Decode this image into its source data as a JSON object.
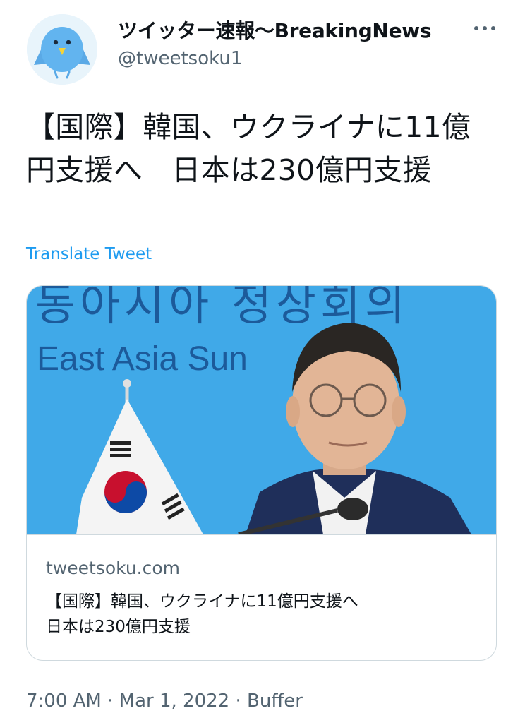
{
  "author": {
    "display_name": "ツイッター速報〜BreakingNews",
    "handle": "@tweetsoku1",
    "avatar_icon": "bird-avatar-icon"
  },
  "more_icon": "more-options-icon",
  "tweet": {
    "text": "【国際】韓国、ウクライナに11億円支援へ　日本は230億円支援",
    "translate_label": "Translate Tweet"
  },
  "card": {
    "image_text_en": "East Asia Sun",
    "image_text_ko": "동아시아 정상회의",
    "domain": "tweetsoku.com",
    "title": "【国際】韓国、ウクライナに11億円支援へ\n日本は230億円支援"
  },
  "meta": {
    "time": "7:00 AM",
    "separator": "·",
    "date": "Mar 1, 2022",
    "source": "Buffer",
    "full": "7:00 AM · Mar 1, 2022 · Buffer"
  },
  "colors": {
    "link": "#1d9bf0",
    "secondary_text": "#536471",
    "border": "#cfd9de",
    "image_background": "#40a9e8"
  }
}
